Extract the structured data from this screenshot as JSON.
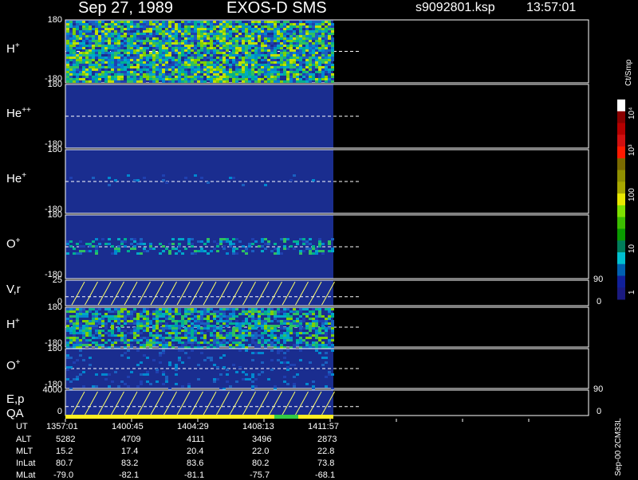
{
  "header": {
    "date": "Sep 27, 1989",
    "instrument": "EXOS-D SMS",
    "file": "s9092801.ksp",
    "time": "13:57:01"
  },
  "panels": [
    {
      "id": "hp1",
      "label": "H",
      "sup": "+",
      "y_top": "180",
      "y_bottom": "-180"
    },
    {
      "id": "hepp",
      "label": "He",
      "sup": "++",
      "y_top": "180",
      "y_bottom": "-180"
    },
    {
      "id": "hep",
      "label": "He",
      "sup": "+",
      "y_top": "180",
      "y_bottom": "-180"
    },
    {
      "id": "op1",
      "label": "O",
      "sup": "+",
      "y_top": "180",
      "y_bottom": "-180"
    },
    {
      "id": "vr",
      "label": "V,r",
      "sup": "",
      "y_top": "25",
      "y_bottom": "0",
      "right_top": "90",
      "right_bottom": "0"
    },
    {
      "id": "hp2",
      "label": "H",
      "sup": "+",
      "y_top": "180",
      "y_bottom": "-180"
    },
    {
      "id": "op2",
      "label": "O",
      "sup": "+",
      "y_top": "180",
      "y_bottom": "-180"
    },
    {
      "id": "ep",
      "label": "E,p",
      "sup": "",
      "y_top": "4000",
      "y_bottom": "0",
      "right_top": "90",
      "right_bottom": "0"
    }
  ],
  "qa_label": "QA",
  "colorbar": {
    "unit": "Ct/Smp",
    "ticks": [
      "10⁴",
      "10³",
      "100",
      "10",
      "1"
    ],
    "colors": [
      "#ffffff",
      "#8b0000",
      "#b40000",
      "#d01010",
      "#ff1a00",
      "#7a6a00",
      "#8f8f00",
      "#a8a800",
      "#e8e800",
      "#7ee000",
      "#3cbd00",
      "#0a9a00",
      "#007d5a",
      "#00c0d0",
      "#0060b0",
      "#10209a",
      "#1a1a80"
    ]
  },
  "footer_code": "Sep-00 2CM33L",
  "ephemeris": {
    "labels": [
      "UT",
      "ALT",
      "MLT",
      "InLat",
      "MLat"
    ],
    "columns": [
      [
        "1357:01",
        "5282",
        "15.2",
        "80.7",
        "-79.0"
      ],
      [
        "1400:45",
        "4709",
        "17.4",
        "83.2",
        "-82.1"
      ],
      [
        "1404:29",
        "4111",
        "20.4",
        "83.6",
        "-81.1"
      ],
      [
        "1408:13",
        "3496",
        "22.0",
        "80.2",
        "-75.7"
      ],
      [
        "1411:57",
        "2873",
        "22.8",
        "73.8",
        "-68.1"
      ]
    ]
  },
  "colors": {
    "background": "#000000",
    "panel_fill": "#1a2d8f",
    "sweep": "#ffff66",
    "qa_good": "#ffee22",
    "qa_alt": "#33cc44"
  }
}
